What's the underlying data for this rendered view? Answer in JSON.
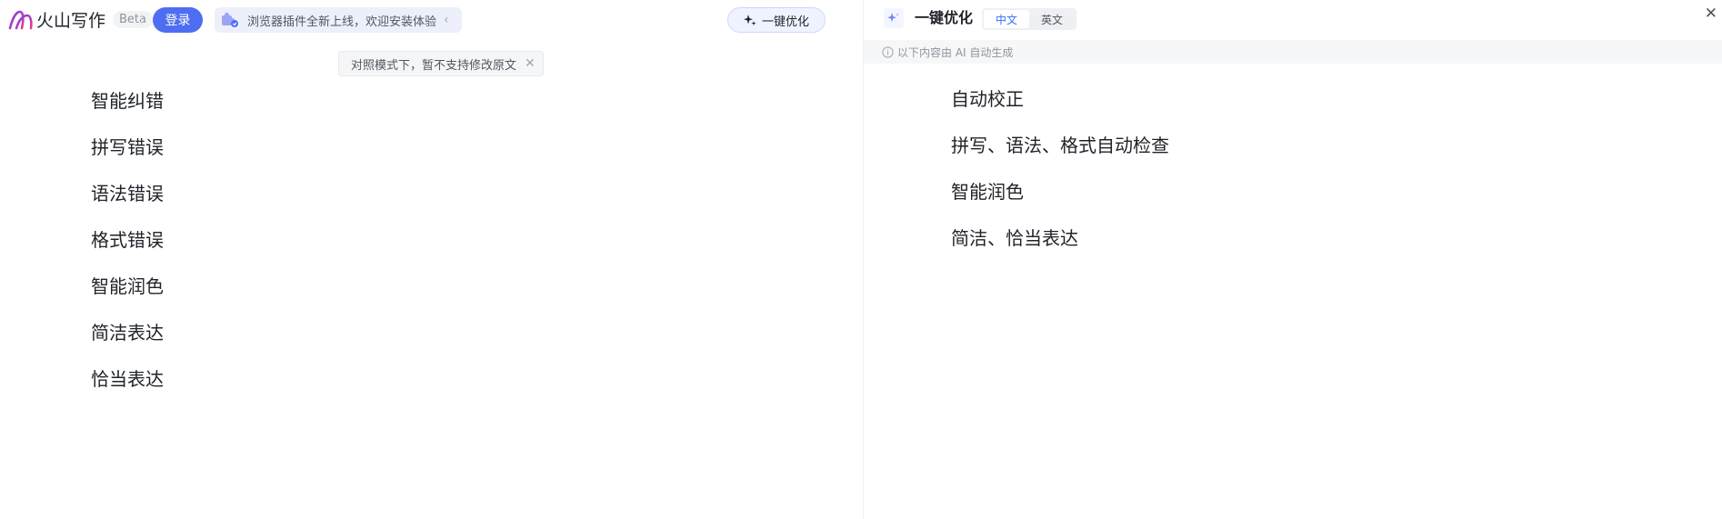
{
  "header": {
    "app_name": "火山写作",
    "beta_badge": "Beta",
    "login_label": "登录",
    "plugin_banner_text": "浏览器插件全新上线，欢迎安装体验",
    "optimize_label": "一键优化"
  },
  "notice": {
    "compare_mode_text": "对照模式下，暂不支持修改原文"
  },
  "document": {
    "lines": [
      "智能纠错",
      "拼写错误",
      "语法错误",
      "格式错误",
      "智能润色",
      "简洁表达",
      "恰当表达"
    ]
  },
  "panel": {
    "title": "一键优化",
    "languages": [
      "中文",
      "英文"
    ],
    "active_language": "中文",
    "ai_note": "以下内容由 AI 自动生成",
    "results": [
      "自动校正",
      "拼写、语法、格式自动检查",
      "智能润色",
      "简洁、恰当表达"
    ]
  },
  "colors": {
    "accent": "#4e6ef2",
    "lang_active": "#3370ff",
    "logo_gradient": [
      "#7b3fe4",
      "#e23b9b"
    ]
  },
  "icons": {
    "logo": "volcano-logo-icon",
    "plugin": "plugin-puzzle-icon",
    "sparkle": "sparkle-icon",
    "close": "close-icon",
    "info": "info-icon",
    "chevron": "chevron-left-icon"
  }
}
